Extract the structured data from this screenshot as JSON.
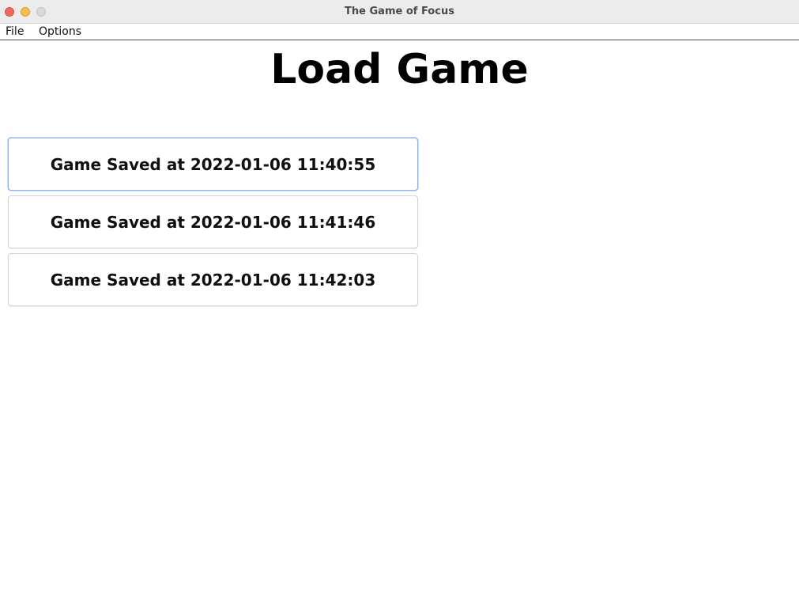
{
  "window": {
    "title": "The Game of Focus"
  },
  "menubar": {
    "items": [
      {
        "label": "File"
      },
      {
        "label": "Options"
      }
    ]
  },
  "main": {
    "heading": "Load Game",
    "saves": [
      {
        "label": "Game Saved at 2022-01-06 11:40:55",
        "focused": true
      },
      {
        "label": "Game Saved at 2022-01-06 11:41:46",
        "focused": false
      },
      {
        "label": "Game Saved at 2022-01-06 11:42:03",
        "focused": false
      }
    ]
  },
  "colors": {
    "close": "#ee6a5e",
    "minimize": "#f5bd4f",
    "maximize": "#d9d9d9",
    "focus_ring": "#8fb6ea"
  }
}
